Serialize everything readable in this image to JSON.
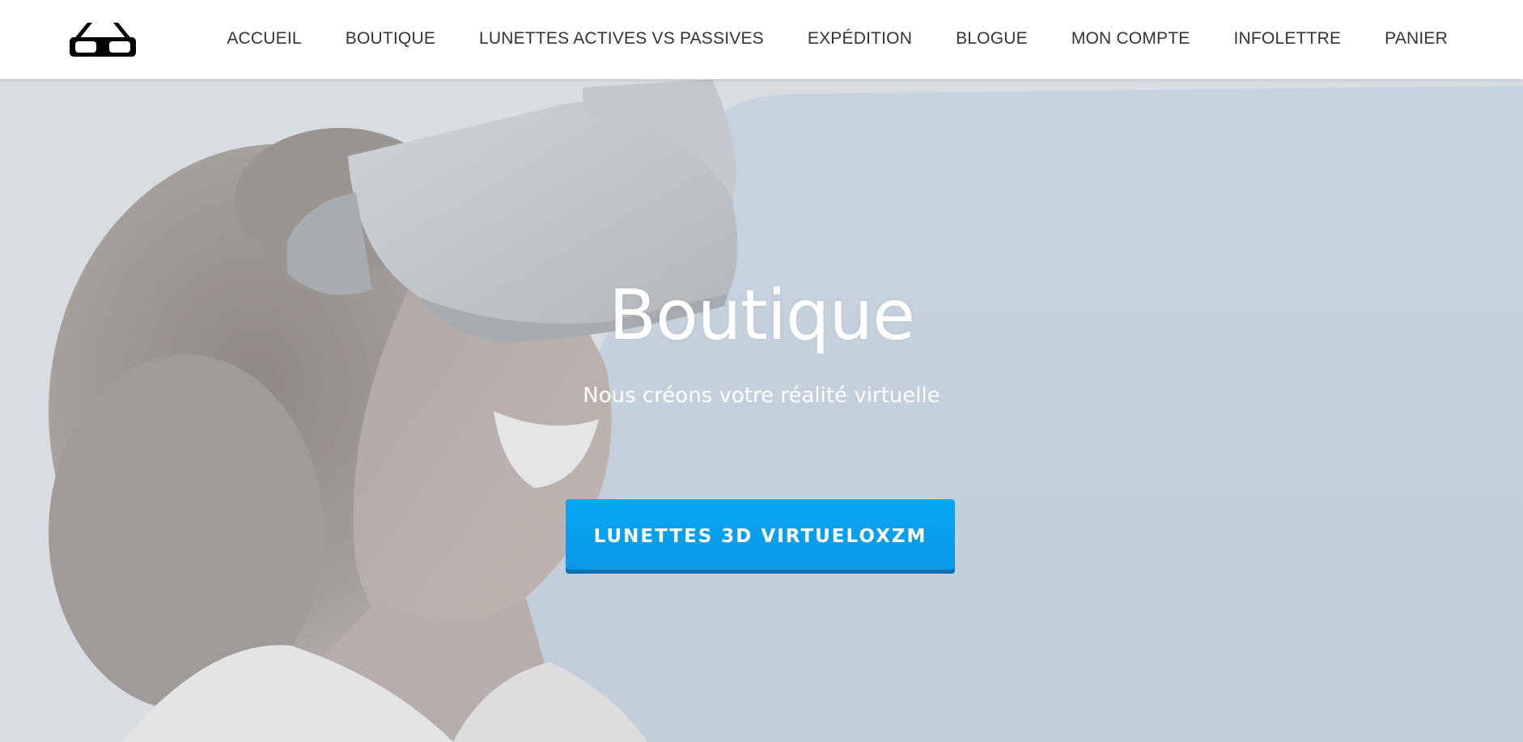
{
  "nav": {
    "items": [
      {
        "label": "ACCUEIL"
      },
      {
        "label": "BOUTIQUE"
      },
      {
        "label": "LUNETTES ACTIVES VS PASSIVES"
      },
      {
        "label": "EXPÉDITION"
      },
      {
        "label": "BLOGUE"
      },
      {
        "label": "MON COMPTE"
      },
      {
        "label": "INFOLETTRE"
      },
      {
        "label": "PANIER"
      }
    ]
  },
  "logo": {
    "icon": "3d-glasses-icon"
  },
  "hero": {
    "title": "Boutique",
    "subtitle": "Nous créons votre réalité virtuelle",
    "cta_label": "LUNETTES 3D VIRTUELOXZM",
    "image": "woman-wearing-vr-headset-photo"
  },
  "colors": {
    "accent": "#07a6f3",
    "accent_dark": "#0a6fb0",
    "nav_text": "#333333",
    "header_bg": "#ffffff"
  }
}
